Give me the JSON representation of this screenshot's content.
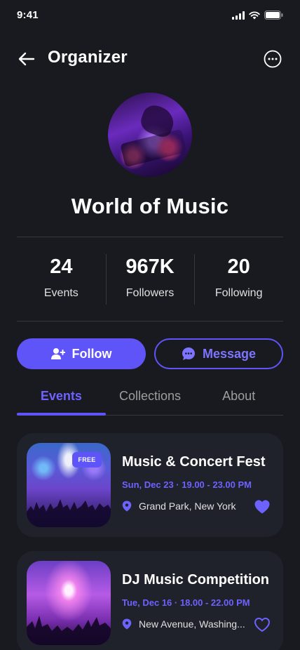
{
  "status_bar": {
    "time": "9:41"
  },
  "header": {
    "title": "Organizer"
  },
  "organizer": {
    "name": "World of Music"
  },
  "stats": [
    {
      "value": "24",
      "label": "Events"
    },
    {
      "value": "967K",
      "label": "Followers"
    },
    {
      "value": "20",
      "label": "Following"
    }
  ],
  "actions": {
    "follow_label": "Follow",
    "message_label": "Message"
  },
  "tabs": [
    {
      "label": "Events",
      "active": true
    },
    {
      "label": "Collections",
      "active": false
    },
    {
      "label": "About",
      "active": false
    }
  ],
  "events": [
    {
      "badge": "FREE",
      "title": "Music & Concert Fest",
      "date": "Sun, Dec 23 · 19.00 - 23.00 PM",
      "location": "Grand Park, New York",
      "favorited": true
    },
    {
      "title": "DJ Music Competition",
      "date": "Tue, Dec 16 · 18.00 - 22.00 PM",
      "location": "New Avenue, Washing...",
      "favorited": false
    }
  ],
  "colors": {
    "accent": "#5F54F8",
    "background": "#181A20",
    "card": "#1F222A"
  }
}
